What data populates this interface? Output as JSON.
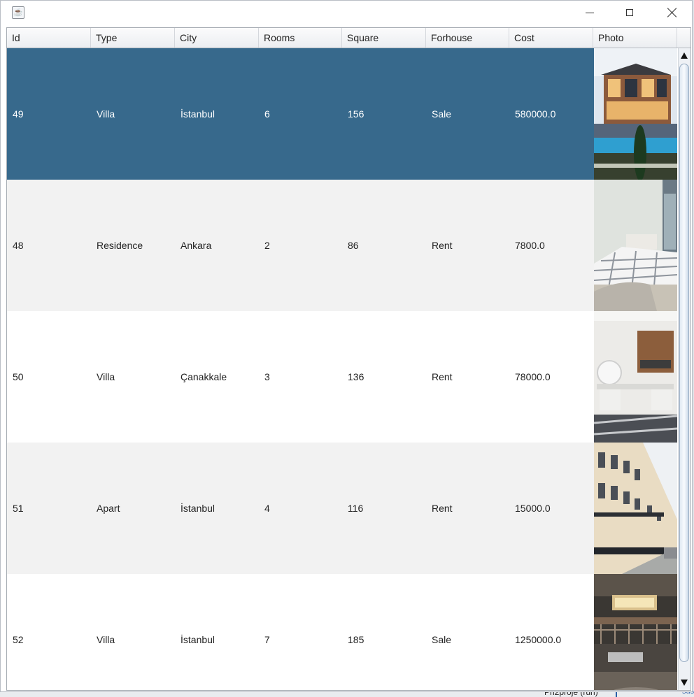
{
  "window": {
    "title": "",
    "icon": "java-cup-icon",
    "controls": [
      "minimize-icon",
      "maximize-icon",
      "close-icon"
    ]
  },
  "table": {
    "columns": [
      "Id",
      "Type",
      "City",
      "Rooms",
      "Square",
      "Forhouse",
      "Cost",
      "Photo"
    ],
    "rows": [
      {
        "id": "49",
        "type": "Villa",
        "city": "İstanbul",
        "rooms": "6",
        "square": "156",
        "forhouse": "Sale",
        "cost": "580000.0",
        "photo": "villa-exterior-photo",
        "selected": true
      },
      {
        "id": "48",
        "type": "Residence",
        "city": "Ankara",
        "rooms": "2",
        "square": "86",
        "forhouse": "Rent",
        "cost": "7800.0",
        "photo": "bedroom-photo",
        "selected": false
      },
      {
        "id": "50",
        "type": "Villa",
        "city": "Çanakkale",
        "rooms": "3",
        "square": "136",
        "forhouse": "Rent",
        "cost": "78000.0",
        "photo": "dressing-room-photo",
        "selected": false
      },
      {
        "id": "51",
        "type": "Apart",
        "city": "İstanbul",
        "rooms": "4",
        "square": "116",
        "forhouse": "Rent",
        "cost": "15000.0",
        "photo": "terraced-street-photo",
        "selected": false
      },
      {
        "id": "52",
        "type": "Villa",
        "city": "İstanbul",
        "rooms": "7",
        "square": "185",
        "forhouse": "Sale",
        "cost": "1250000.0",
        "photo": "modern-interior-photo",
        "selected": false
      }
    ]
  },
  "colors": {
    "selection": "#37698c",
    "row_alt": "#f2f2f2",
    "row": "#ffffff"
  }
}
